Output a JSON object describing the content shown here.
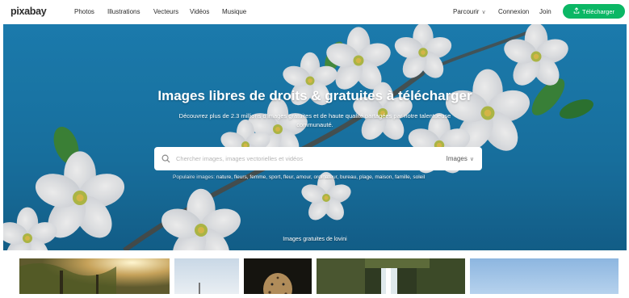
{
  "brand": {
    "logo": "pixabay"
  },
  "nav": {
    "items": [
      {
        "label": "Photos"
      },
      {
        "label": "Illustrations"
      },
      {
        "label": "Vecteurs"
      },
      {
        "label": "Vidéos"
      },
      {
        "label": "Musique"
      }
    ],
    "explore": "Parcourir",
    "login": "Connexion",
    "join": "Join",
    "upload": "Télécharger"
  },
  "hero": {
    "title": "Images libres de droits & gratuites à télécharger",
    "subtitle": "Découvrez plus de 2.3 millions d'images gratuites et de haute qualité partagées par notre talentueuse communauté.",
    "credit": "Images gratuites de lovini"
  },
  "search": {
    "placeholder": "Chercher images, images vectorielles et vidéos",
    "type": "Images"
  },
  "popular": {
    "label": "Populaire images:",
    "tags": "nature, fleurs, femme, sport, fleur, amour, ordinateur, bureau, plage, maison, famille, soleil"
  },
  "colors": {
    "accent": "#0bb765",
    "sky": "#1a7aae"
  }
}
